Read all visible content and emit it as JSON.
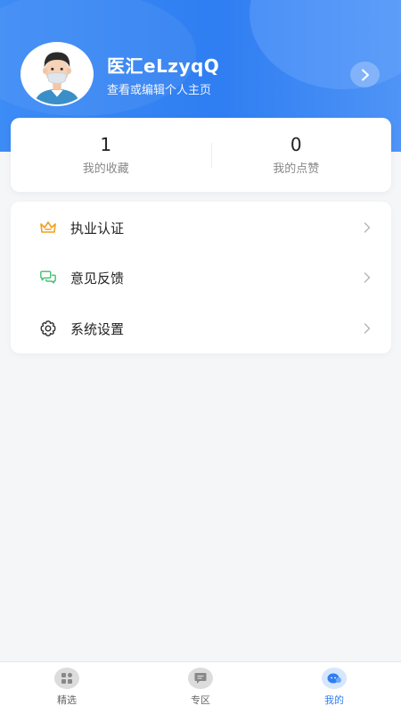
{
  "profile": {
    "username": "医汇eLzyqQ",
    "subtitle": "查看或编辑个人主页"
  },
  "stats": [
    {
      "value": "1",
      "label": "我的收藏"
    },
    {
      "value": "0",
      "label": "我的点赞"
    }
  ],
  "menu": [
    {
      "label": "执业认证",
      "icon": "crown-icon",
      "color": "#f0a020"
    },
    {
      "label": "意见反馈",
      "icon": "chat-bubbles-icon",
      "color": "#3cc06a"
    },
    {
      "label": "系统设置",
      "icon": "gear-icon",
      "color": "#333333"
    }
  ],
  "tabbar": {
    "tabs": [
      {
        "label": "精选",
        "icon": "grid-icon",
        "active": false
      },
      {
        "label": "专区",
        "icon": "message-board-icon",
        "active": false
      },
      {
        "label": "我的",
        "icon": "profile-icon",
        "active": true
      }
    ]
  },
  "colors": {
    "accent": "#2f7ef2",
    "header_gradient_start": "#3d8bf5",
    "header_gradient_end": "#4f94f6",
    "background": "#f5f6f8"
  }
}
